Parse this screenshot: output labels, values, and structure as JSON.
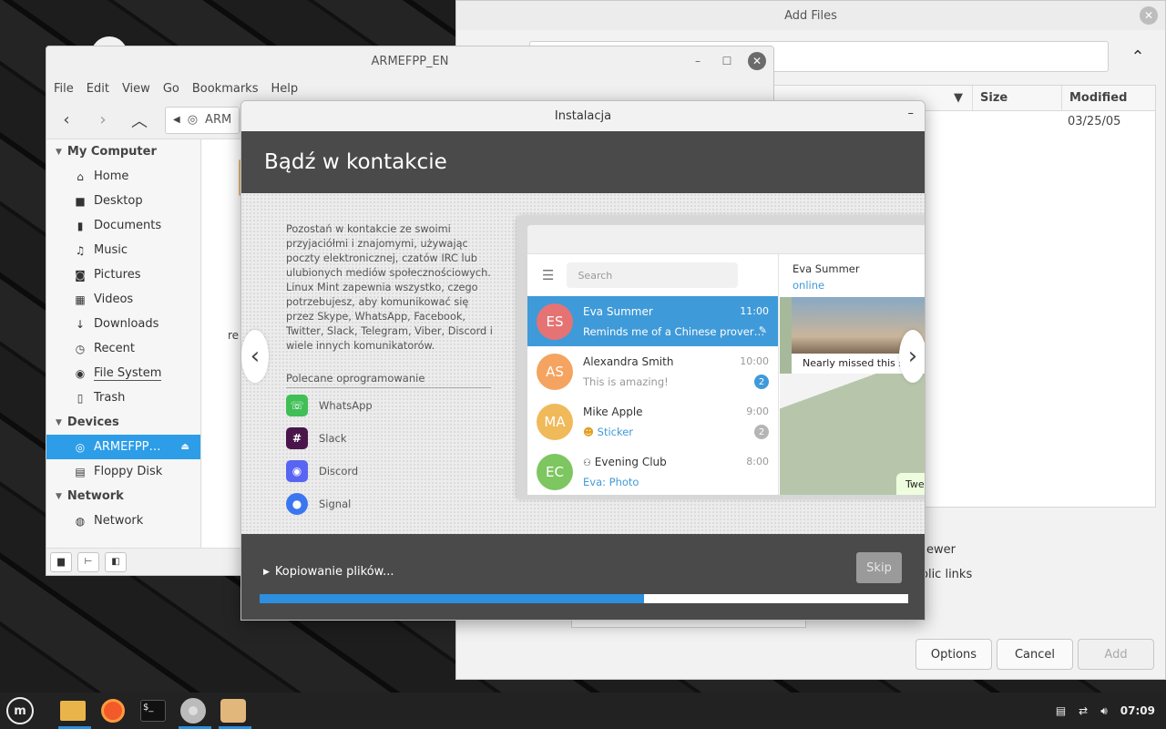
{
  "add_files": {
    "title": "Add Files",
    "columns": [
      "Size",
      "Modified"
    ],
    "row_modified": "03/25/05",
    "check1_text": "ewer",
    "check2_text": "olic links",
    "buttons": [
      "Options",
      "Cancel",
      "Add"
    ]
  },
  "file_manager": {
    "title": "ARMEFPP_EN",
    "menu": [
      "File",
      "Edit",
      "View",
      "Go",
      "Bookmarks",
      "Help"
    ],
    "breadcrumb": "ARM",
    "content_peek_label": "re",
    "sidebar": {
      "my_computer": "My Computer",
      "places": [
        "Home",
        "Desktop",
        "Documents",
        "Music",
        "Pictures",
        "Videos",
        "Downloads",
        "Recent",
        "File System",
        "Trash"
      ],
      "devices": "Devices",
      "device_items": [
        "ARMEFPP…",
        "Floppy Disk"
      ],
      "network": "Network",
      "network_items": [
        "Network"
      ]
    }
  },
  "installer": {
    "title": "Instalacja",
    "heading": "Bądź w kontakcie",
    "description": "Pozostań w kontakcie ze swoimi przyjaciółmi i znajomymi, używając poczty elektronicznej, czatów IRC lub ulubionych mediów społecznościowych. Linux Mint zapewnia wszystko, czego potrzebujesz, aby komunikować się przez Skype, WhatsApp, Facebook, Twitter, Slack, Telegram, Viber, Discord i wiele innych komunikatorów.",
    "recommended_title": "Polecane oprogramowanie",
    "apps": [
      "WhatsApp",
      "Slack",
      "Discord",
      "Signal"
    ],
    "status": "Kopiowanie plików...",
    "skip_label": "Skip",
    "progress": 0.593,
    "colors": {
      "accent": "#2d8fdf",
      "header_bg": "#4a4a4a"
    },
    "telegram": {
      "search_placeholder": "Search",
      "chats": [
        {
          "initials": "ES",
          "name": "Eva Summer",
          "time": "11:00",
          "message": "Reminds me of a Chinese prover…",
          "color": "#e57373"
        },
        {
          "initials": "AS",
          "name": "Alexandra Smith",
          "time": "10:00",
          "message": "This is amazing!",
          "badge": "2",
          "color": "#f4a460"
        },
        {
          "initials": "MA",
          "name": "Mike Apple",
          "time": "9:00",
          "message": "Sticker",
          "badge": "2",
          "color": "#f0b95a"
        },
        {
          "initials": "EC",
          "name": "Evening Club",
          "time": "8:00",
          "message": "Eva: Photo",
          "color": "#7dc660"
        }
      ],
      "contact_name": "Eva Summer",
      "contact_status": "online",
      "photo_caption": "Nearly missed this s",
      "bubble_text": "Twe"
    }
  },
  "taskbar": {
    "clock": "07:09"
  }
}
